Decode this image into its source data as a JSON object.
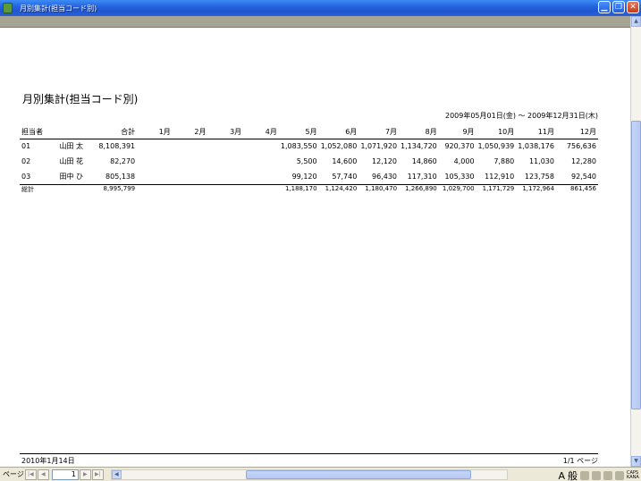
{
  "window": {
    "title": "月別集計(担当コード別)"
  },
  "report": {
    "title": "月別集計(担当コード別)",
    "range": "2009年05月01日(金) ～ 2009年12月31日(木)",
    "headers": [
      "担当者",
      "",
      "合計",
      "1月",
      "2月",
      "3月",
      "4月",
      "5月",
      "6月",
      "7月",
      "8月",
      "9月",
      "10月",
      "11月",
      "12月"
    ],
    "rows": [
      {
        "code": "01",
        "name": "山田 太",
        "total": "8,108,391",
        "m1": "",
        "m2": "",
        "m3": "",
        "m4": "",
        "m5": "1,083,550",
        "m6": "1,052,080",
        "m7": "1,071,920",
        "m8": "1,134,720",
        "m9": "920,370",
        "m10": "1,050,939",
        "m11": "1,038,176",
        "m12": "756,636"
      },
      {
        "code": "02",
        "name": "山田 花",
        "total": "82,270",
        "m1": "",
        "m2": "",
        "m3": "",
        "m4": "",
        "m5": "5,500",
        "m6": "14,600",
        "m7": "12,120",
        "m8": "14,860",
        "m9": "4,000",
        "m10": "7,880",
        "m11": "11,030",
        "m12": "12,280"
      },
      {
        "code": "03",
        "name": "田中 ひ",
        "total": "805,138",
        "m1": "",
        "m2": "",
        "m3": "",
        "m4": "",
        "m5": "99,120",
        "m6": "57,740",
        "m7": "96,430",
        "m8": "117,310",
        "m9": "105,330",
        "m10": "112,910",
        "m11": "123,758",
        "m12": "92,540"
      }
    ],
    "grand_total": {
      "label": "総計",
      "total": "8,995,799",
      "m5": "1,188,170",
      "m6": "1,124,420",
      "m7": "1,180,470",
      "m8": "1,266,890",
      "m9": "1,029,700",
      "m10": "1,171,729",
      "m11": "1,172,964",
      "m12": "861,456"
    },
    "footer_date": "2010年1月14日",
    "footer_page": "1/1 ページ"
  },
  "nav": {
    "label": "ページ",
    "page_value": "1",
    "first": "|◀",
    "prev": "◀",
    "next": "▶",
    "last": "▶|"
  },
  "ime": {
    "mode_a": "A",
    "mode_kan": "般",
    "caps": "CAPS",
    "kana": "KANA"
  },
  "colors": {
    "titlebar": "#2663e0",
    "page": "#ffffff",
    "chrome": "#ece9d8"
  }
}
